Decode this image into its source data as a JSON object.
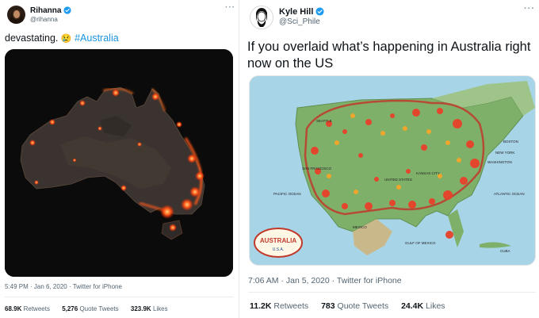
{
  "colors": {
    "link": "#1b95e0",
    "verified": "#1d9bf0",
    "muted": "#536471"
  },
  "tweet_left": {
    "author_name": "Rihanna",
    "handle": "@rihanna",
    "text": "devastating.",
    "emoji": "😢",
    "hashtag": "#Australia",
    "time": "5:49 PM · Jan 6, 2020",
    "source": "Twitter for iPhone",
    "retweets_count": "68.9K",
    "retweets_label": "Retweets",
    "quotes_count": "5,276",
    "quotes_label": "Quote Tweets",
    "likes_count": "323.9K",
    "likes_label": "Likes",
    "more_icon": "more-icon"
  },
  "tweet_right": {
    "author_name": "Kyle Hill",
    "handle": "@Sci_Phile",
    "text": "If you overlaid what’s happening in Australia right now on the US",
    "time": "7:06 AM · Jan 5, 2020",
    "source": "Twitter for iPhone",
    "retweets_count": "11.2K",
    "retweets_label": "Retweets",
    "quotes_count": "783",
    "quotes_label": "Quote Tweets",
    "likes_count": "24.4K",
    "likes_label": "Likes",
    "map": {
      "badge_title": "AUSTRALIA",
      "badge_sub": "U.S.A.",
      "labels": [
        "SEATTLE",
        "SAN FRANCISCO",
        "BOSTON",
        "NEW YORK",
        "WASHINGTON",
        "KANSAS CITY",
        "UNITED STATES",
        "PACIFIC OCEAN",
        "ATLANTIC OCEAN",
        "MEXICO",
        "GULF OF MEXICO",
        "CUBA"
      ]
    }
  }
}
